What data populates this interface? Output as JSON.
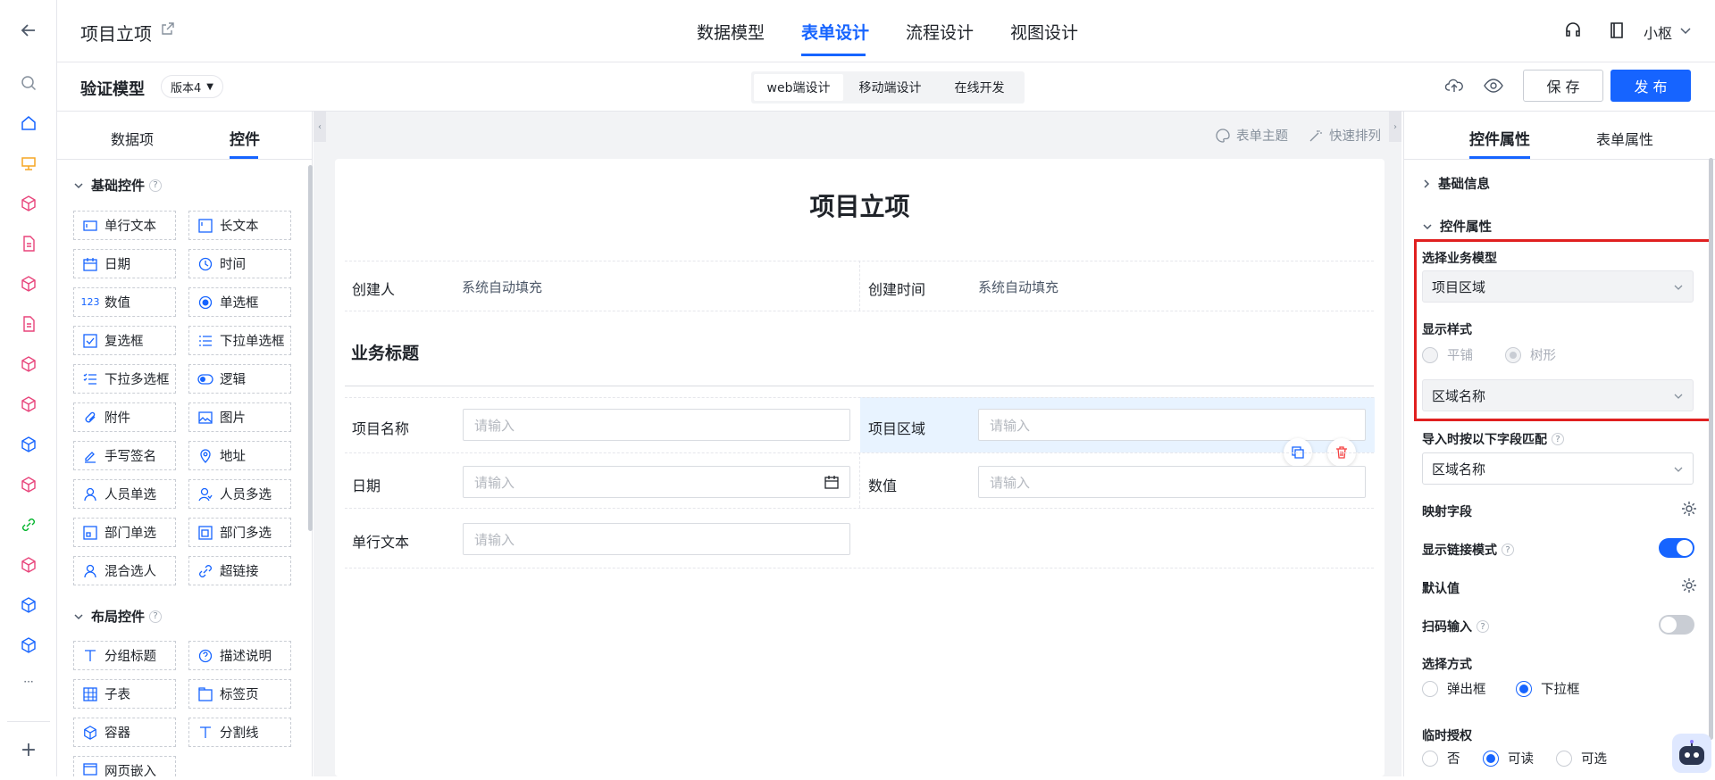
{
  "colors": {
    "primary": "#1664ff",
    "highlight": "#e8f3ff",
    "danger": "#f53f3f",
    "rail_pink": "#e8437a",
    "red_frame": "#e02020"
  },
  "rail": {
    "icons": [
      "back-arrow-icon",
      "search-icon",
      "home-icon",
      "presentation-icon",
      "cube-icon",
      "document-icon",
      "cube-icon",
      "document-icon",
      "cube-icon",
      "cube-icon",
      "cube-icon",
      "cube-icon",
      "link-icon",
      "cube-icon",
      "cube-icon",
      "cube-icon",
      "more-icon",
      "add-icon"
    ],
    "more_label": "···",
    "add_label": "+"
  },
  "header": {
    "title": "项目立项",
    "tabs": [
      "数据模型",
      "表单设计",
      "流程设计",
      "视图设计"
    ],
    "active_tab": "表单设计",
    "user": "小枢"
  },
  "subheader": {
    "model": "验证模型",
    "version": "版本4",
    "modes": [
      "web端设计",
      "移动端设计",
      "在线开发"
    ],
    "save": "保 存",
    "publish": "发 布"
  },
  "left": {
    "tabs": [
      "数据项",
      "控件"
    ],
    "basic_title": "基础控件",
    "basic": [
      "单行文本",
      "长文本",
      "日期",
      "时间",
      "数值",
      "单选框",
      "复选框",
      "下拉单选框",
      "下拉多选框",
      "逻辑",
      "附件",
      "图片",
      "手写签名",
      "地址",
      "人员单选",
      "人员多选",
      "部门单选",
      "部门多选",
      "混合选人",
      "超链接"
    ],
    "layout_title": "布局控件",
    "layout": [
      "分组标题",
      "描述说明",
      "子表",
      "标签页",
      "容器",
      "分割线",
      "网页嵌入"
    ]
  },
  "canvas": {
    "toolbar": [
      "表单主题",
      "快速排列"
    ],
    "form_title": "项目立项",
    "creator_label": "创建人",
    "creator_value": "系统自动填充",
    "ctime_label": "创建时间",
    "ctime_value": "系统自动填充",
    "section": "业务标题",
    "fields": {
      "name": "项目名称",
      "region": "项目区域",
      "date": "日期",
      "number": "数值",
      "text": "单行文本"
    },
    "placeholder": "请输入"
  },
  "right": {
    "tabs": [
      "控件属性",
      "表单属性"
    ],
    "basic_info": "基础信息",
    "ctrl_props": "控件属性",
    "select_model_label": "选择业务模型",
    "select_model_value": "项目区域",
    "display_style_label": "显示样式",
    "style_options": [
      "平铺",
      "树形"
    ],
    "display_field_value": "区域名称",
    "import_match_label": "导入时按以下字段匹配",
    "import_match_value": "区域名称",
    "mapping_label": "映射字段",
    "link_mode_label": "显示链接模式",
    "link_mode_on": true,
    "default_label": "默认值",
    "scan_label": "扫码输入",
    "scan_on": false,
    "select_mode_label": "选择方式",
    "select_mode_options": [
      "弹出框",
      "下拉框"
    ],
    "select_mode_value": "下拉框",
    "temp_auth_label": "临时授权",
    "temp_auth_options": [
      "否",
      "可读",
      "可选"
    ],
    "temp_auth_value": "可读"
  }
}
